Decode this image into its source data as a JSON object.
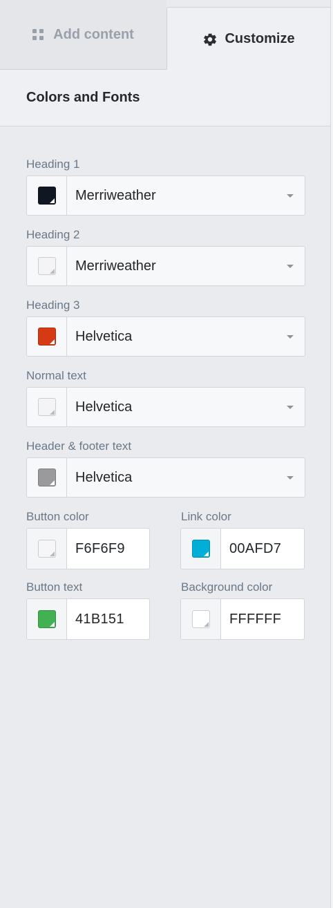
{
  "tabs": {
    "add_content": {
      "label": "Add content",
      "icon": "grid-icon"
    },
    "customize": {
      "label": "Customize",
      "icon": "gear-icon"
    }
  },
  "section": {
    "title": "Colors and Fonts"
  },
  "font_fields": [
    {
      "label": "Heading 1",
      "font": "Merriweather",
      "swatch": "#0f1822"
    },
    {
      "label": "Heading 2",
      "font": "Merriweather",
      "swatch": "#f4f4f6"
    },
    {
      "label": "Heading 3",
      "font": "Helvetica",
      "swatch": "#d63a14"
    },
    {
      "label": "Normal text",
      "font": "Helvetica",
      "swatch": "#f4f4f6"
    },
    {
      "label": "Header & footer text",
      "font": "Helvetica",
      "swatch": "#9a9a9c"
    }
  ],
  "color_fields": [
    {
      "label": "Button color",
      "value": "F6F6F9",
      "swatch": "#f6f6f9"
    },
    {
      "label": "Link color",
      "value": "00AFD7",
      "swatch": "#00afd7"
    },
    {
      "label": "Button text",
      "value": "41B151",
      "swatch": "#41b151"
    },
    {
      "label": "Background color",
      "value": "FFFFFF",
      "swatch": "#ffffff"
    }
  ]
}
